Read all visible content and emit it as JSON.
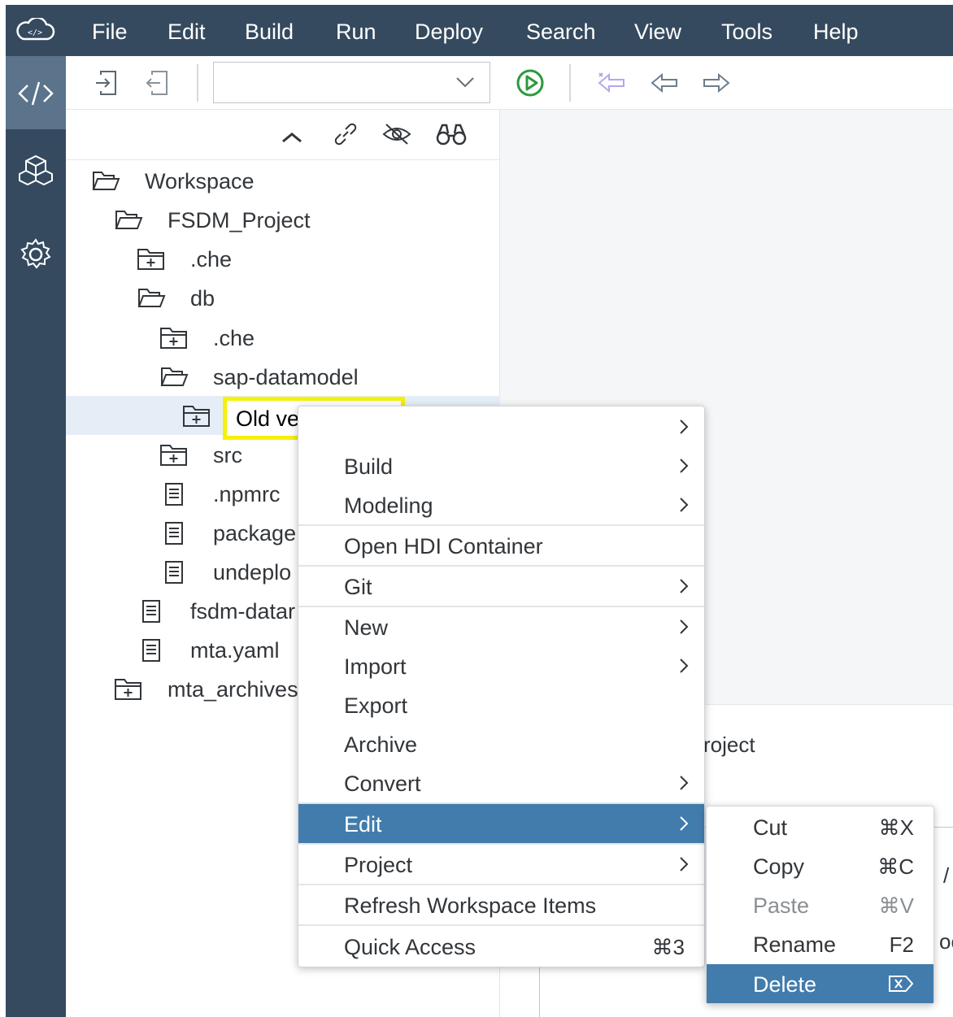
{
  "menubar": {
    "items": [
      "File",
      "Edit",
      "Build",
      "Run",
      "Deploy",
      "Search",
      "View",
      "Tools",
      "Help"
    ]
  },
  "activitybar": {
    "icons": [
      "code-icon",
      "packages-icon",
      "settings-gear-icon"
    ],
    "active": "code-icon"
  },
  "toolbar": {
    "select_value": "",
    "icons": [
      "import-icon",
      "export-icon",
      "run-icon",
      "back-history-icon",
      "back-icon",
      "forward-icon"
    ]
  },
  "explorer": {
    "header_icons": [
      "collapse-icon",
      "link-icon",
      "hide-icon",
      "search-binoculars-icon"
    ],
    "tree": [
      {
        "label": "Workspace",
        "icon": "folder-open-icon",
        "selected": false
      },
      {
        "label": "FSDM_Project",
        "icon": "folder-open-icon",
        "selected": false
      },
      {
        "label": ".che",
        "icon": "folder-closed-icon",
        "selected": false
      },
      {
        "label": "db",
        "icon": "folder-open-icon",
        "selected": false
      },
      {
        "label": ".che",
        "icon": "folder-closed-icon",
        "selected": false
      },
      {
        "label": "sap-datamodel",
        "icon": "folder-open-icon",
        "selected": false
      },
      {
        "label": "",
        "icon": "folder-closed-icon",
        "selected": true
      },
      {
        "label": "src",
        "icon": "folder-closed-icon",
        "selected": false
      },
      {
        "label": ".npmrc",
        "icon": "file-icon",
        "selected": false
      },
      {
        "label": "package",
        "icon": "file-icon",
        "selected": false
      },
      {
        "label": "undeplo",
        "icon": "file-icon",
        "selected": false
      },
      {
        "label": "fsdm-datar",
        "icon": "file-icon",
        "selected": false
      },
      {
        "label": "mta.yaml",
        "icon": "file-icon",
        "selected": false
      },
      {
        "label": "mta_archives",
        "icon": "folder-closed-icon",
        "selected": false
      }
    ]
  },
  "tooltip": {
    "text": "Old version no.",
    "highlight_color": "#f5f10a"
  },
  "context_menu": {
    "items": [
      {
        "label": "",
        "submenu": true
      },
      {
        "label": "Build",
        "submenu": true
      },
      {
        "label": "Modeling",
        "submenu": true
      },
      {
        "label": "Open HDI Container",
        "submenu": false
      },
      {
        "label": "Git",
        "submenu": true
      },
      {
        "label": "New",
        "submenu": true
      },
      {
        "label": "Import",
        "submenu": true
      },
      {
        "label": "Export",
        "submenu": false
      },
      {
        "label": "Archive",
        "submenu": false
      },
      {
        "label": "Convert",
        "submenu": true
      },
      {
        "label": "Edit",
        "submenu": true,
        "active": true
      },
      {
        "label": "Project",
        "submenu": true
      },
      {
        "label": "Refresh Workspace Items",
        "submenu": false
      },
      {
        "label": "Quick Access",
        "submenu": false,
        "shortcut": "⌘3"
      }
    ]
  },
  "edit_submenu": {
    "items": [
      {
        "label": "Cut",
        "shortcut": "⌘X",
        "disabled": false
      },
      {
        "label": "Copy",
        "shortcut": "⌘C",
        "disabled": false
      },
      {
        "label": "Paste",
        "shortcut": "⌘V",
        "disabled": true
      },
      {
        "label": "Rename",
        "shortcut": "F2",
        "disabled": false
      },
      {
        "label": "Delete",
        "shortcut": "⌦",
        "disabled": false,
        "active": true
      }
    ]
  },
  "bottom_panel": {
    "title_fragment": "roject",
    "fragment_1": "/ N",
    "fragment_2": "oc"
  },
  "colors": {
    "shell": "#354a5f",
    "active_activity": "#5b738b",
    "menu_active": "#427cac",
    "run_green": "#2b9a3b",
    "nav_purple": "#8b6cc7"
  }
}
